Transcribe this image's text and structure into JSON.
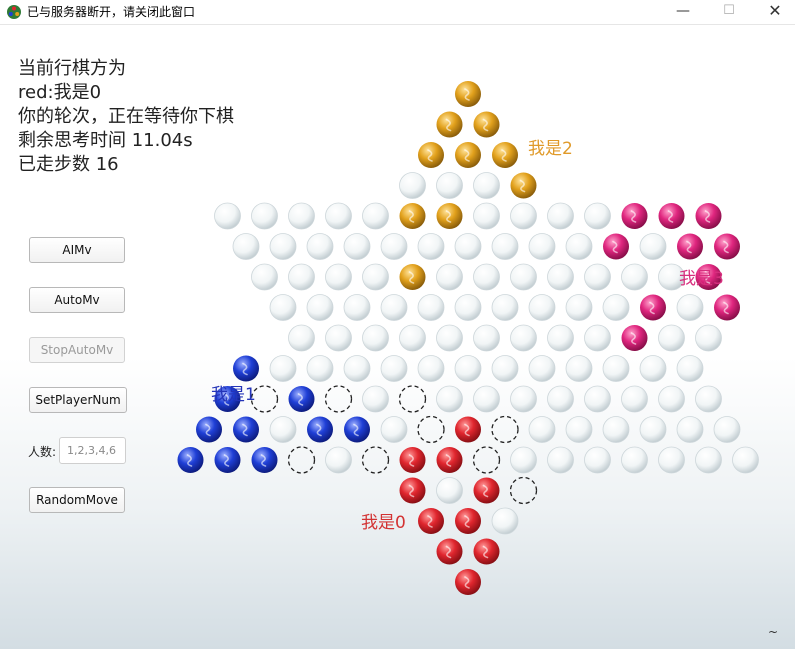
{
  "window": {
    "title": "已与服务器断开，请关闭此窗口",
    "minimize_glyph": "—",
    "maximize_glyph": "☐",
    "close_glyph": "✕"
  },
  "status": {
    "line1": "当前行棋方为",
    "line2": "red:我是0",
    "line3": "你的轮次，正在等待你下棋",
    "line4": "剩余思考时间 11.04s",
    "line5": "已走步数 16"
  },
  "controls": {
    "aimv": "AIMv",
    "automv": "AutoMv",
    "stopautomv": "StopAutoMv",
    "setplayernum": "SetPlayerNum",
    "players_label": "人数:",
    "players_placeholder": "1,2,3,4,6",
    "randommove": "RandomMove"
  },
  "player_labels": {
    "p0": "我是0",
    "p1": "我是1",
    "p2": "我是2",
    "p3": "我是3"
  },
  "colors": {
    "red": "#e0262e",
    "blue": "#1f3fd6",
    "yellow": "#e2a11c",
    "magenta": "#e0267f",
    "empty": "#e9eef0",
    "p0_label": "#d33333",
    "p1_label": "#2434b8",
    "p2_label": "#e09a2a",
    "p3_label": "#d72f7e"
  },
  "corner_text": "~",
  "board": {
    "rows": [
      "Y",
      "YY",
      "YYY",
      "OOOY",
      "OOOOOYYOOOOMMM",
      "OOOOOOOOOOMOMM",
      "OOOOYOOOOOOOM",
      "OOOOOOOOOOMOM",
      "OOOOOOOOOMOO",
      "BOOOOOOOOOOOO",
      "BDBDODOOOOOOOO",
      "BBOBBODRDOOOOOO",
      "BBBDODRRDOOOOOOO",
      "RORD",
      "RRO",
      "RR",
      "R"
    ]
  }
}
